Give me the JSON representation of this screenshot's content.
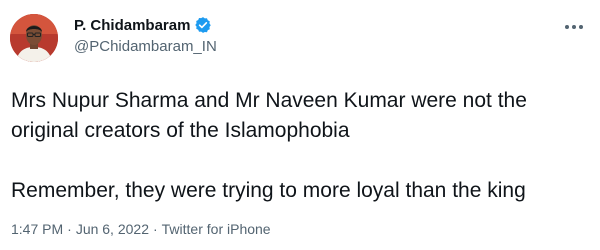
{
  "author": {
    "display_name": "P. Chidambaram",
    "handle": "@PChidambaram_IN",
    "verified": true,
    "avatar_icon": "profile-photo",
    "verified_color": "#1d9bf0"
  },
  "tweet": {
    "line1": "Mrs Nupur Sharma and Mr Naveen Kumar were not the",
    "line2": "original creators of the Islamophobia",
    "line3": "Remember, they were trying to more loyal than the king"
  },
  "meta": {
    "time": "1:47 PM",
    "separator": "·",
    "date": "Jun 6, 2022",
    "source": "Twitter for iPhone"
  },
  "icons": {
    "more": "more-options-icon"
  }
}
